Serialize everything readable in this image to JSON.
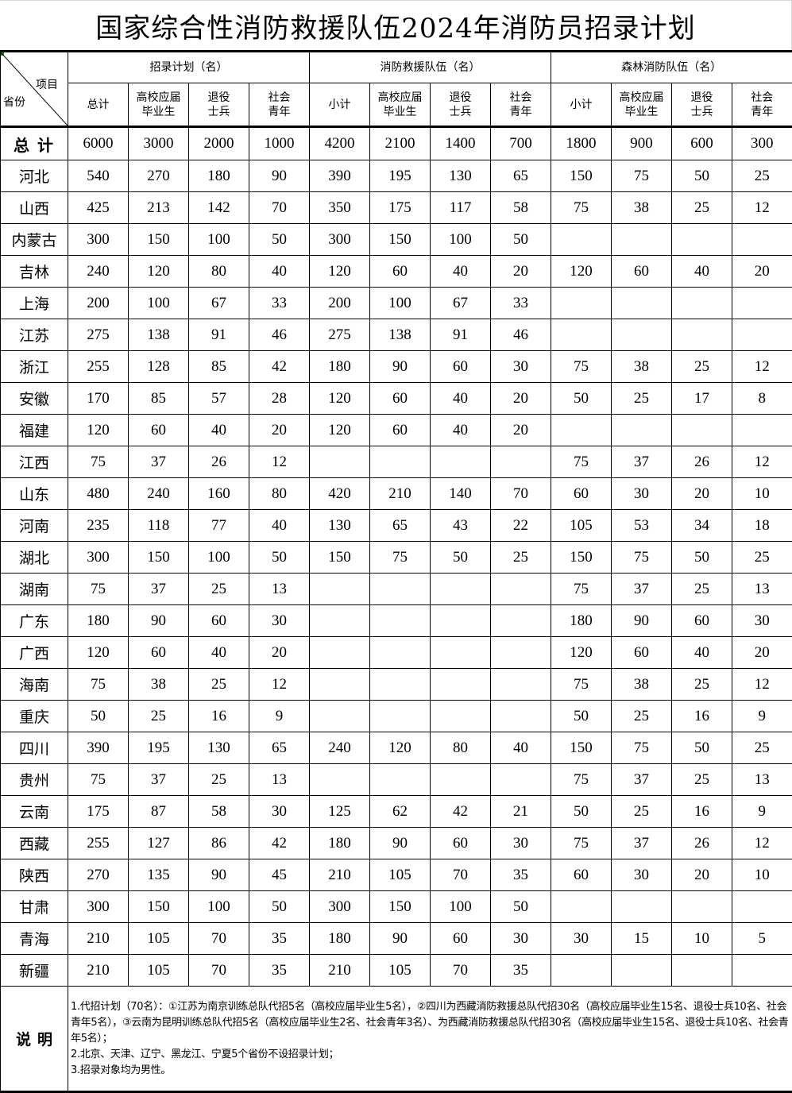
{
  "title": "国家综合性消防救援队伍2024年消防员招录计划",
  "header": {
    "corner_item": "项目",
    "corner_province": "省份",
    "groups": [
      "招录计划（名）",
      "消防救援队伍（名）",
      "森林消防队伍（名）"
    ],
    "subheaders": [
      [
        "总计",
        "高校应届\n毕业生",
        "退役\n士兵",
        "社会\n青年"
      ],
      [
        "小计",
        "高校应届\n毕业生",
        "退役\n士兵",
        "社会\n青年"
      ],
      [
        "小计",
        "高校应届\n毕业生",
        "退役\n士兵",
        "社会\n青年"
      ]
    ]
  },
  "total": {
    "label": "总计",
    "values": [
      "6000",
      "3000",
      "2000",
      "1000",
      "4200",
      "2100",
      "1400",
      "700",
      "1800",
      "900",
      "600",
      "300"
    ]
  },
  "rows": [
    {
      "province": "河北",
      "values": [
        "540",
        "270",
        "180",
        "90",
        "390",
        "195",
        "130",
        "65",
        "150",
        "75",
        "50",
        "25"
      ]
    },
    {
      "province": "山西",
      "values": [
        "425",
        "213",
        "142",
        "70",
        "350",
        "175",
        "117",
        "58",
        "75",
        "38",
        "25",
        "12"
      ]
    },
    {
      "province": "内蒙古",
      "values": [
        "300",
        "150",
        "100",
        "50",
        "300",
        "150",
        "100",
        "50",
        "",
        "",
        "",
        ""
      ]
    },
    {
      "province": "吉林",
      "values": [
        "240",
        "120",
        "80",
        "40",
        "120",
        "60",
        "40",
        "20",
        "120",
        "60",
        "40",
        "20"
      ]
    },
    {
      "province": "上海",
      "values": [
        "200",
        "100",
        "67",
        "33",
        "200",
        "100",
        "67",
        "33",
        "",
        "",
        "",
        ""
      ]
    },
    {
      "province": "江苏",
      "values": [
        "275",
        "138",
        "91",
        "46",
        "275",
        "138",
        "91",
        "46",
        "",
        "",
        "",
        ""
      ]
    },
    {
      "province": "浙江",
      "values": [
        "255",
        "128",
        "85",
        "42",
        "180",
        "90",
        "60",
        "30",
        "75",
        "38",
        "25",
        "12"
      ]
    },
    {
      "province": "安徽",
      "values": [
        "170",
        "85",
        "57",
        "28",
        "120",
        "60",
        "40",
        "20",
        "50",
        "25",
        "17",
        "8"
      ]
    },
    {
      "province": "福建",
      "values": [
        "120",
        "60",
        "40",
        "20",
        "120",
        "60",
        "40",
        "20",
        "",
        "",
        "",
        ""
      ]
    },
    {
      "province": "江西",
      "values": [
        "75",
        "37",
        "26",
        "12",
        "",
        "",
        "",
        "",
        "75",
        "37",
        "26",
        "12"
      ]
    },
    {
      "province": "山东",
      "values": [
        "480",
        "240",
        "160",
        "80",
        "420",
        "210",
        "140",
        "70",
        "60",
        "30",
        "20",
        "10"
      ]
    },
    {
      "province": "河南",
      "values": [
        "235",
        "118",
        "77",
        "40",
        "130",
        "65",
        "43",
        "22",
        "105",
        "53",
        "34",
        "18"
      ]
    },
    {
      "province": "湖北",
      "values": [
        "300",
        "150",
        "100",
        "50",
        "150",
        "75",
        "50",
        "25",
        "150",
        "75",
        "50",
        "25"
      ]
    },
    {
      "province": "湖南",
      "values": [
        "75",
        "37",
        "25",
        "13",
        "",
        "",
        "",
        "",
        "75",
        "37",
        "25",
        "13"
      ]
    },
    {
      "province": "广东",
      "values": [
        "180",
        "90",
        "60",
        "30",
        "",
        "",
        "",
        "",
        "180",
        "90",
        "60",
        "30"
      ]
    },
    {
      "province": "广西",
      "values": [
        "120",
        "60",
        "40",
        "20",
        "",
        "",
        "",
        "",
        "120",
        "60",
        "40",
        "20"
      ]
    },
    {
      "province": "海南",
      "values": [
        "75",
        "38",
        "25",
        "12",
        "",
        "",
        "",
        "",
        "75",
        "38",
        "25",
        "12"
      ]
    },
    {
      "province": "重庆",
      "values": [
        "50",
        "25",
        "16",
        "9",
        "",
        "",
        "",
        "",
        "50",
        "25",
        "16",
        "9"
      ]
    },
    {
      "province": "四川",
      "values": [
        "390",
        "195",
        "130",
        "65",
        "240",
        "120",
        "80",
        "40",
        "150",
        "75",
        "50",
        "25"
      ]
    },
    {
      "province": "贵州",
      "values": [
        "75",
        "37",
        "25",
        "13",
        "",
        "",
        "",
        "",
        "75",
        "37",
        "25",
        "13"
      ]
    },
    {
      "province": "云南",
      "values": [
        "175",
        "87",
        "58",
        "30",
        "125",
        "62",
        "42",
        "21",
        "50",
        "25",
        "16",
        "9"
      ]
    },
    {
      "province": "西藏",
      "values": [
        "255",
        "127",
        "86",
        "42",
        "180",
        "90",
        "60",
        "30",
        "75",
        "37",
        "26",
        "12"
      ]
    },
    {
      "province": "陕西",
      "values": [
        "270",
        "135",
        "90",
        "45",
        "210",
        "105",
        "70",
        "35",
        "60",
        "30",
        "20",
        "10"
      ]
    },
    {
      "province": "甘肃",
      "values": [
        "300",
        "150",
        "100",
        "50",
        "300",
        "150",
        "100",
        "50",
        "",
        "",
        "",
        ""
      ]
    },
    {
      "province": "青海",
      "values": [
        "210",
        "105",
        "70",
        "35",
        "180",
        "90",
        "60",
        "30",
        "30",
        "15",
        "10",
        "5"
      ]
    },
    {
      "province": "新疆",
      "values": [
        "210",
        "105",
        "70",
        "35",
        "210",
        "105",
        "70",
        "35",
        "",
        "",
        "",
        ""
      ]
    }
  ],
  "notes": {
    "label": "说明",
    "lines": [
      "1.代招计划（70名）：①江苏为南京训练总队代招5名（高校应届毕业生5名），②四川为西藏消防救援总队代招30名（高校应届毕业生15名、退役士兵10名、社会青年5名），③云南为昆明训练总队代招5名（高校应届毕业生2名、社会青年3名）、为西藏消防救援总队代招30名（高校应届毕业生15名、退役士兵10名、社会青年5名）；",
      "2.北京、天津、辽宁、黑龙江、宁夏5个省份不设招录计划；",
      "3.招录对象均为男性。"
    ]
  }
}
